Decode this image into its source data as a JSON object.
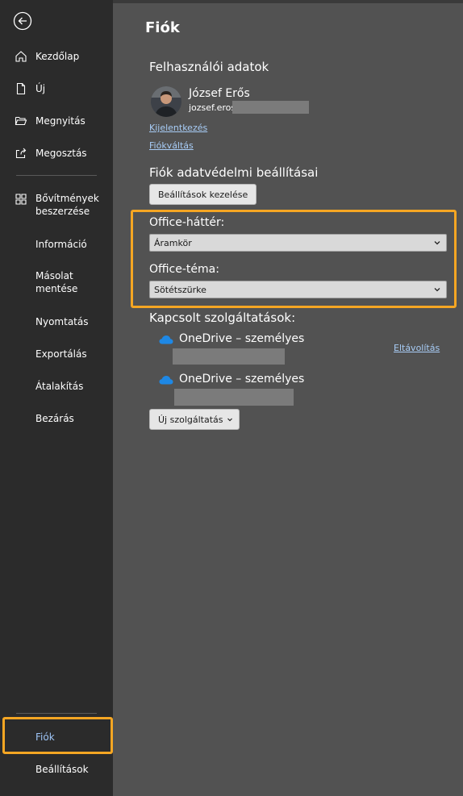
{
  "sidebar": {
    "back_label": "Vissza",
    "items": [
      {
        "label": "Kezdőlap",
        "icon": "home-icon"
      },
      {
        "label": "Új",
        "icon": "new-document-icon"
      },
      {
        "label": "Megnyitás",
        "icon": "folder-open-icon"
      },
      {
        "label": "Megosztás",
        "icon": "share-icon"
      },
      {
        "label": "Bővítmények\nbeszerzése",
        "icon": "addins-grid-icon"
      },
      {
        "label": "Információ"
      },
      {
        "label": "Másolat\nmentése"
      },
      {
        "label": "Nyomtatás"
      },
      {
        "label": "Exportálás"
      },
      {
        "label": "Átalakítás"
      },
      {
        "label": "Bezárás"
      }
    ],
    "bottom_items": [
      {
        "label": "Fiók",
        "active": true
      },
      {
        "label": "Beállítások"
      }
    ]
  },
  "main": {
    "title": "Fiók",
    "user_section": {
      "title": "Felhasználói adatok",
      "name": "József Erős",
      "email_visible": "jozsef.eros",
      "sign_out": "Kijelentkezés",
      "switch_account": "Fiókváltás"
    },
    "privacy": {
      "title": "Fiók adatvédelmi beállításai",
      "button": "Beállítások kezelése"
    },
    "office_background": {
      "label": "Office-háttér:",
      "selected": "Áramkör"
    },
    "office_theme": {
      "label": "Office-téma:",
      "selected": "Sötétszürke"
    },
    "connected": {
      "title": "Kapcsolt szolgáltatások:",
      "services": [
        {
          "name": "OneDrive – személyes",
          "action": "Eltávolítás"
        },
        {
          "name": "OneDrive – személyes"
        }
      ],
      "add_button": "Új szolgáltatás"
    }
  },
  "colors": {
    "sidebar_bg": "#2b2b2b",
    "main_bg": "#525252",
    "highlight": "#f5a623",
    "link": "#a8cdf7",
    "onedrive": "#1e88e5"
  }
}
